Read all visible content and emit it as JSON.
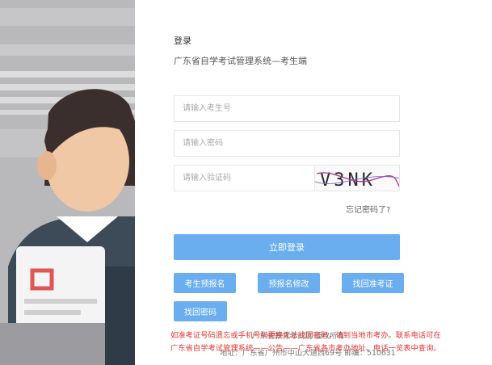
{
  "login": {
    "title": "登录",
    "subtitle": "广东省自学考试管理系统—考生端"
  },
  "form": {
    "exam_number_placeholder": "请输入考生号",
    "password_placeholder": "请输入密码",
    "captcha_placeholder": "请输入验证码",
    "captcha_text": "V3NK",
    "forgot_password": "忘记密码了?"
  },
  "buttons": {
    "login": "立即登录",
    "pre_register": "考生预报名",
    "modify_registration": "预报名修改",
    "retrieve_exam_card": "找回准考证",
    "retrieve_password": "找回密码"
  },
  "notice": {
    "line1": "如准考证号码遗忘或手机号码更换无法找回密码，请到当地市考办。联系电话可在",
    "line2": "广东省自学考试管理系统——公告——广东省各市考办地址、电话一览表中查询。"
  },
  "footer": {
    "copyright": "广东省教育考试院 版权所有",
    "address": "地址：广东省广州市中山大道西69号 邮编：510631"
  },
  "colors": {
    "primary_button": "#6aaef0",
    "notice_text": "#e43434",
    "left_background": "#b9b9bc"
  }
}
